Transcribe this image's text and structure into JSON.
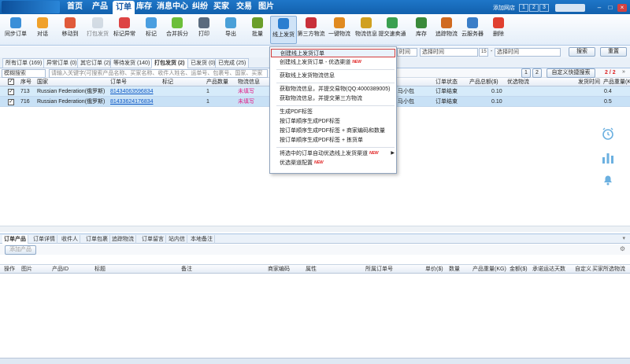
{
  "nav": {
    "items": [
      "首页",
      "产品",
      "订单",
      "库存",
      "消息中心",
      "纠纷",
      "买家",
      "交易",
      "图片"
    ],
    "active_index": 2,
    "add_shop": "添加网店",
    "pages": [
      "1",
      "2",
      "3"
    ]
  },
  "toolbar": [
    {
      "label": "同步订单",
      "icon": "sync-icon",
      "color": "#3a8fd8"
    },
    {
      "label": "对话",
      "icon": "chat-icon",
      "color": "#f0a12a"
    },
    {
      "label": "移动到",
      "icon": "move-icon",
      "color": "#e05a3a"
    },
    {
      "label": "打包发货",
      "icon": "package-icon",
      "color": "#b8c4d0"
    },
    {
      "label": "标记异常",
      "icon": "flag-icon",
      "color": "#d44"
    },
    {
      "label": "标记",
      "icon": "tag-icon",
      "color": "#4a9ee0"
    },
    {
      "label": "合并拆分",
      "icon": "merge-icon",
      "color": "#6cbf3a"
    },
    {
      "label": "打印",
      "icon": "print-icon",
      "color": "#5a6b7e"
    },
    {
      "label": "导出",
      "icon": "export-icon",
      "color": "#4aa0d8"
    },
    {
      "label": "批量",
      "icon": "batch-icon",
      "color": "#6a9e2a"
    },
    {
      "label": "线上发货",
      "icon": "ship-online-icon",
      "color": "#2a7ed0"
    },
    {
      "label": "第三方物流",
      "icon": "third-party-icon",
      "color": "#c8303a"
    },
    {
      "label": "一键物流",
      "icon": "one-click-icon",
      "color": "#e08a20"
    },
    {
      "label": "物流信息",
      "icon": "logistics-info-icon",
      "color": "#d0a020"
    },
    {
      "label": "提交速卖通",
      "icon": "submit-icon",
      "color": "#3aa050"
    },
    {
      "label": "库存",
      "icon": "inventory-icon",
      "color": "#3a8a3a"
    },
    {
      "label": "追踪物流",
      "icon": "track-icon",
      "color": "#d06a20"
    },
    {
      "label": "云服务器",
      "icon": "cloud-icon",
      "color": "#3a7ec8"
    },
    {
      "label": "删除",
      "icon": "delete-icon",
      "color": "#e04030"
    }
  ],
  "filter": {
    "time_type": "时间",
    "start_placeholder": "选择时间",
    "end_placeholder": "选择时间",
    "calendar_day": "15",
    "search": "搜索",
    "reset": "重置"
  },
  "tabs": [
    "所有订单 (169)",
    "异常订单 (0)",
    "其它订单 (2)",
    "等待发货 (140)",
    "打包发货 (2)",
    "已发货 (0)",
    "已完成 (25)"
  ],
  "active_tab": 4,
  "search": {
    "mode": "模糊搜索",
    "placeholder": "请输入关键字(可搜索产品名称、买家名称、收件人姓名、运单号、包裹号、国家、买家",
    "page_1": "1",
    "page_2": "2",
    "custom_search": "自定义快捷搜索",
    "page_count": "2 / 2"
  },
  "columns": [
    "序号",
    "国家",
    "订单号",
    "标记",
    "产品数量",
    "物流信息",
    "订单状态",
    "产品总额($)",
    "优选物流",
    "发货时间",
    "产品重量(K"
  ],
  "rows": [
    {
      "index": "713",
      "country": "Russian Federation(俄罗斯)",
      "order": "81434063596834",
      "qty": "1",
      "logistics": "未填写",
      "carrier": "马小包",
      "status": "订单结束",
      "amount": "0.10",
      "weight": "0.4"
    },
    {
      "index": "716",
      "country": "Russian Federation(俄罗斯)",
      "order": "81433624176834",
      "qty": "1",
      "logistics": "未填写",
      "carrier": "马小包",
      "status": "订单结束",
      "amount": "0.10",
      "weight": "0.5"
    }
  ],
  "menu": [
    {
      "label": "创建线上发货订单",
      "new": false,
      "selected": true
    },
    {
      "label": "创建线上发货订单 - 优选渠道",
      "new": true
    },
    {
      "sep": true
    },
    {
      "label": "获取线上发货物流信息",
      "new": false
    },
    {
      "sep": true
    },
    {
      "label": "获取物流信息，并提交易物(QQ:4000389005)",
      "new": false
    },
    {
      "label": "获取物流信息，并提交第三方物流",
      "new": false
    },
    {
      "sep": true
    },
    {
      "label": "生成PDF标签",
      "new": false
    },
    {
      "label": "按订单顺序生成PDF标签",
      "new": false
    },
    {
      "label": "按订单顺序生成PDF标签 + 商家编码和数量",
      "new": false
    },
    {
      "label": "按订单顺序生成PDF标签 + 拣货单",
      "new": false
    },
    {
      "sep": true
    },
    {
      "label": "将选中的订单自动优选线上发货渠道",
      "new": true,
      "submenu": true
    },
    {
      "label": "优选渠道配置",
      "new": true
    }
  ],
  "new_badge": "NEW",
  "bottom_tabs": [
    "订单产品",
    "订单详情",
    "收件人",
    "订单包裹",
    "追踪物流",
    "订单留言",
    "站内信",
    "本地备注"
  ],
  "add_product": "添加产品",
  "bottom_columns": [
    "操作",
    "图片",
    "产品ID",
    "标题",
    "备注",
    "商家编码",
    "属性",
    "所属订单号",
    "单价($)",
    "数量",
    "产品重量(KG)",
    "金额($)",
    "承诺运达天数",
    "自定义",
    "买家所选物流"
  ]
}
